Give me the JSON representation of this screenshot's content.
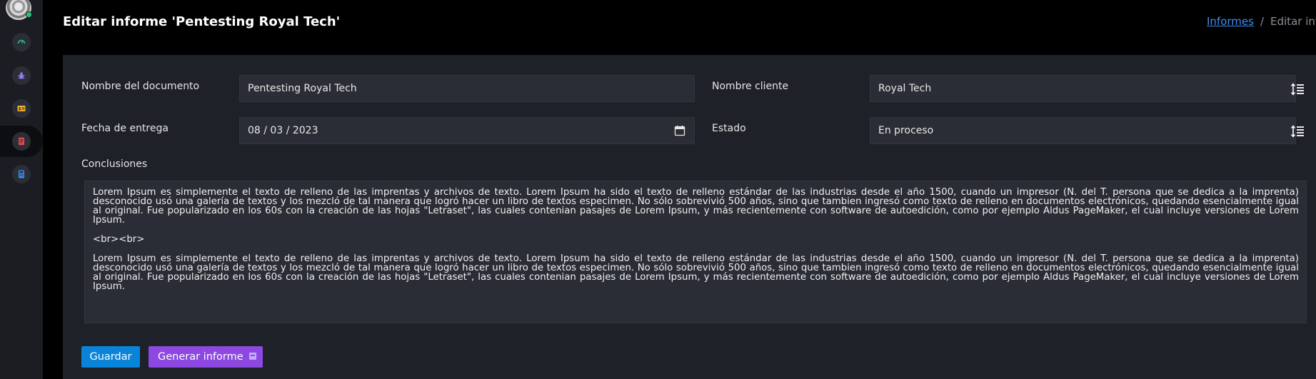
{
  "header": {
    "title": "Editar informe 'Pentesting Royal Tech'",
    "breadcrumb": {
      "link": "Informes",
      "separator": "/",
      "current": "Editar informe"
    }
  },
  "sidebar": {
    "items": [
      {
        "icon": "gauge-icon",
        "color": "#2fbf71"
      },
      {
        "icon": "bug-icon",
        "color": "#8e7cf0"
      },
      {
        "icon": "id-card-icon",
        "color": "#f0b429"
      },
      {
        "icon": "document-icon",
        "color": "#e5484d",
        "active": true
      },
      {
        "icon": "calculator-icon",
        "color": "#3b8ef0"
      }
    ]
  },
  "form": {
    "document_name": {
      "label": "Nombre del documento",
      "value": "Pentesting Royal Tech"
    },
    "client_name": {
      "label": "Nombre cliente",
      "value": "Royal Tech"
    },
    "delivery_date": {
      "label": "Fecha de entrega",
      "value": "08 / 03 / 2023"
    },
    "status": {
      "label": "Estado",
      "value": "En proceso"
    },
    "conclusions": {
      "label": "Conclusiones",
      "paragraph1": "Lorem Ipsum es simplemente el texto de relleno de las imprentas y archivos de texto. Lorem Ipsum ha sido el texto de relleno estándar de las industrias desde el año 1500, cuando un impresor (N. del T. persona que se dedica a la imprenta) desconocido usó una galería de textos y los mezcló de tal manera que logró hacer un libro de textos especimen. No sólo sobrevivió 500 años, sino que tambien ingresó como texto de relleno en documentos electrónicos, quedando esencialmente igual al original. Fue popularizado en los 60s con la creación de las hojas \"Letraset\", las cuales contenian pasajes de Lorem Ipsum, y más recientemente con software de autoedición, como por ejemplo Aldus PageMaker, el cual incluye versiones de Lorem Ipsum.",
      "separator": "<br><br>",
      "paragraph2": "Lorem Ipsum es simplemente el texto de relleno de las imprentas y archivos de texto. Lorem Ipsum ha sido el texto de relleno estándar de las industrias desde el año 1500, cuando un impresor (N. del T. persona que se dedica a la imprenta) desconocido usó una galería de textos y los mezcló de tal manera que logró hacer un libro de textos especimen. No sólo sobrevivió 500 años, sino que tambien ingresó como texto de relleno en documentos electrónicos, quedando esencialmente igual al original. Fue popularizado en los 60s con la creación de las hojas \"Letraset\", las cuales contenian pasajes de Lorem Ipsum, y más recientemente con software de autoedición, como por ejemplo Aldus PageMaker, el cual incluye versiones de Lorem Ipsum."
    }
  },
  "actions": {
    "save_label": "Guardar",
    "generate_label": "Generar informe"
  },
  "colors": {
    "save_button": "#0a84d9",
    "generate_button": "#8c48e0",
    "link": "#3b8ef0"
  }
}
